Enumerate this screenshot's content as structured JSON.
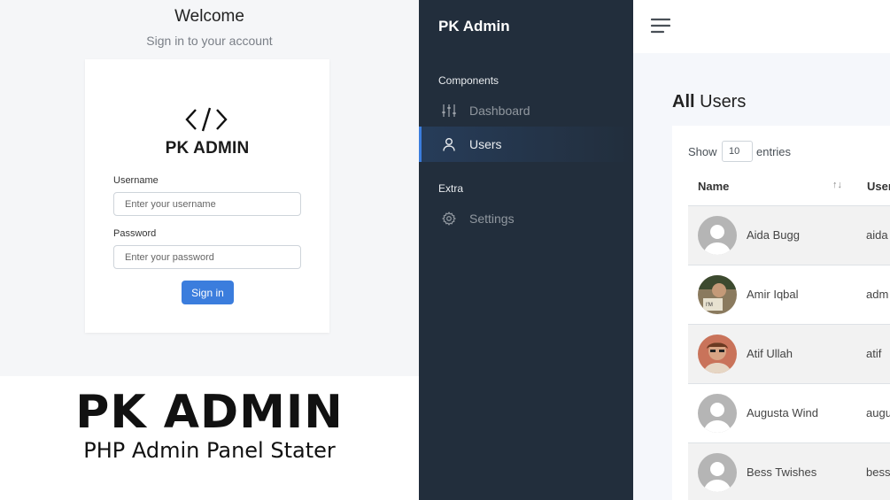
{
  "login": {
    "welcome": "Welcome",
    "subtitle": "Sign in to your account",
    "brand": "PK ADMIN",
    "username_label": "Username",
    "username_placeholder": "Enter your username",
    "password_label": "Password",
    "password_placeholder": "Enter your password",
    "signin_label": "Sign in"
  },
  "promo": {
    "title": "PK ADMIN",
    "subtitle": "PHP Admin Panel Stater"
  },
  "sidebar": {
    "brand": "PK Admin",
    "sections": [
      {
        "header": "Components",
        "items": [
          {
            "label": "Dashboard",
            "icon": "sliders-icon",
            "active": false
          },
          {
            "label": "Users",
            "icon": "user-icon",
            "active": true
          }
        ]
      },
      {
        "header": "Extra",
        "items": [
          {
            "label": "Settings",
            "icon": "settings-icon",
            "active": false
          }
        ]
      }
    ]
  },
  "main": {
    "title_bold": "All",
    "title_rest": " Users",
    "show_label": "Show",
    "entries_value": "10",
    "entries_label": "entries",
    "columns": [
      "Name",
      "User"
    ],
    "rows": [
      {
        "name": "Aida Bugg",
        "username": "aida",
        "avatar": "default"
      },
      {
        "name": "Amir Iqbal",
        "username": "adm",
        "avatar": "photo"
      },
      {
        "name": "Atif Ullah",
        "username": "atif",
        "avatar": "photo"
      },
      {
        "name": "Augusta Wind",
        "username": "augu",
        "avatar": "default"
      },
      {
        "name": "Bess Twishes",
        "username": "bess",
        "avatar": "default"
      }
    ]
  },
  "colors": {
    "sidebar_bg": "#222e3c",
    "accent": "#3b7ddd",
    "page_bg": "#f5f7fb"
  }
}
